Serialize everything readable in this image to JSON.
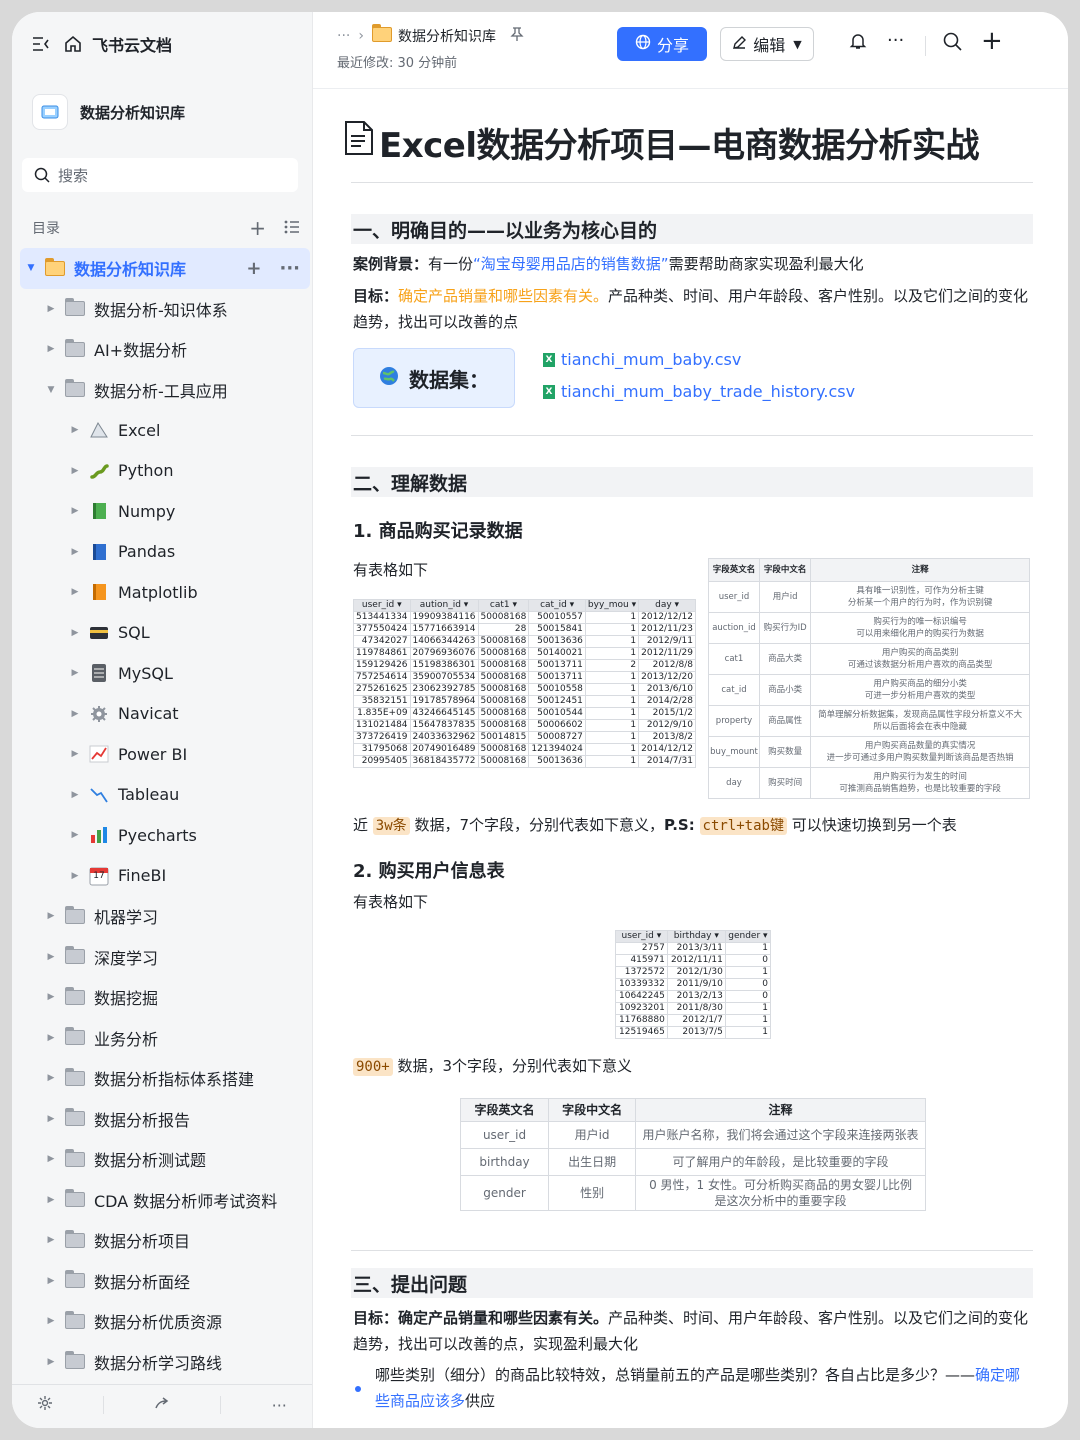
{
  "sidebar": {
    "app_name": "飞书云文档",
    "kb_name": "数据分析知识库",
    "search_placeholder": "搜索",
    "toc_label": "目录",
    "root": "数据分析知识库",
    "items": [
      {
        "label": "数据分析-知识体系",
        "level": 1
      },
      {
        "label": "AI+数据分析",
        "level": 1
      },
      {
        "label": "数据分析-工具应用",
        "level": 1,
        "expanded": true
      },
      {
        "label": "Excel",
        "level": 2,
        "icon": "chart-icon"
      },
      {
        "label": "Python",
        "level": 2,
        "icon": "snake-icon"
      },
      {
        "label": "Numpy",
        "level": 2,
        "icon": "green-book-icon"
      },
      {
        "label": "Pandas",
        "level": 2,
        "icon": "blue-book-icon"
      },
      {
        "label": "Matplotlib",
        "level": 2,
        "icon": "orange-book-icon"
      },
      {
        "label": "SQL",
        "level": 2,
        "icon": "card-icon"
      },
      {
        "label": "MySQL",
        "level": 2,
        "icon": "database-icon"
      },
      {
        "label": "Navicat",
        "level": 2,
        "icon": "gear-icon"
      },
      {
        "label": "Power BI",
        "level": 2,
        "icon": "line-chart-icon"
      },
      {
        "label": "Tableau",
        "level": 2,
        "icon": "trend-icon"
      },
      {
        "label": "Pyecharts",
        "level": 2,
        "icon": "bar-chart-icon"
      },
      {
        "label": "FineBI",
        "level": 2,
        "icon": "calendar-icon"
      },
      {
        "label": "机器学习",
        "level": 1
      },
      {
        "label": "深度学习",
        "level": 1
      },
      {
        "label": "数据挖掘",
        "level": 1
      },
      {
        "label": "业务分析",
        "level": 1
      },
      {
        "label": "数据分析指标体系搭建",
        "level": 1
      },
      {
        "label": "数据分析报告",
        "level": 1
      },
      {
        "label": "数据分析测试题",
        "level": 1
      },
      {
        "label": "CDA 数据分析师考试资料",
        "level": 1
      },
      {
        "label": "数据分析项目",
        "level": 1
      },
      {
        "label": "数据分析面经",
        "level": 1
      },
      {
        "label": "数据分析优质资源",
        "level": 1
      },
      {
        "label": "数据分析学习路线",
        "level": 1
      }
    ],
    "calendar_num": "17"
  },
  "header": {
    "breadcrumb_more": "···",
    "breadcrumb_current": "数据分析知识库",
    "modified": "最近修改: 30 分钟前",
    "share": "分享",
    "edit": "编辑"
  },
  "doc": {
    "title": "Excel数据分析项目—电商数据分析实战",
    "s1": "一、明确目的——以业务为核心目的",
    "bg_label": "案例背景：",
    "bg_pre": "有一份",
    "bg_link": "“淘宝母婴用品店的销售数据”",
    "bg_post": "需要帮助商家实现盈利最大化",
    "goal_label": "目标：",
    "goal_hl": "确定产品销量和哪些因素有关。",
    "goal_rest": "产品种类、时间、用户年龄段、客户性别。以及它们之间的变化趋势，找出可以改善的点",
    "dataset_label": "数据集：",
    "file1": "tianchi_mum_baby.csv",
    "file2": "tianchi_mum_baby_trade_history.csv",
    "s2": "二、理解数据",
    "h21": "1. 商品购买记录数据",
    "table_intro": "有表格如下",
    "p21_a": "近",
    "p21_code": "3w条",
    "p21_b": "数据，7个字段，分别代表如下意义，",
    "p21_ps": "P.S:",
    "p21_code2": "ctrl+tab键",
    "p21_c": "可以快速切换到另一个表",
    "h22": "2. 购买用户信息表",
    "table_intro2": "有表格如下",
    "p22_code": "900+",
    "p22_rest": "数据，3个字段，分别代表如下意义",
    "s3": "三、提出问题",
    "goal2_label": "目标：确定产品销量和哪些因素有关。",
    "goal2_rest": "产品种类、时间、用户年龄段、客户性别。以及它们之间的变化趋势，找出可以改善的点，实现盈利最大化",
    "q1_text": "哪些类别（细分）的商品比较特效，总销量前五的产品是哪些类别？各自占比是多少？——",
    "q1_link": "确定哪些商品应该多",
    "q1_end": "供应"
  },
  "sheet1": {
    "headers": [
      "user_id",
      "aution_id",
      "cat1",
      "cat_id",
      "byy_mou",
      "day"
    ],
    "rows": [
      [
        "513441334",
        "19909384116",
        "50008168",
        "50010557",
        "1",
        "2012/12/12"
      ],
      [
        "377550424",
        "15771663914",
        "28",
        "50015841",
        "1",
        "2012/11/23"
      ],
      [
        "47342027",
        "14066344263",
        "50008168",
        "50013636",
        "1",
        "2012/9/11"
      ],
      [
        "119784861",
        "20796936076",
        "50008168",
        "50140021",
        "1",
        "2012/11/29"
      ],
      [
        "159129426",
        "15198386301",
        "50008168",
        "50013711",
        "2",
        "2012/8/8"
      ],
      [
        "757254614",
        "35900705534",
        "50008168",
        "50013711",
        "1",
        "2013/12/20"
      ],
      [
        "275261625",
        "23062392785",
        "50008168",
        "50010558",
        "1",
        "2013/6/10"
      ],
      [
        "35832151",
        "19178578964",
        "50008168",
        "50012451",
        "1",
        "2014/2/28"
      ],
      [
        "1.835E+09",
        "43246645145",
        "50008168",
        "50010544",
        "1",
        "2015/1/2"
      ],
      [
        "131021484",
        "15647837835",
        "50008168",
        "50006602",
        "1",
        "2012/9/10"
      ],
      [
        "373726419",
        "24033632962",
        "50014815",
        "50008727",
        "1",
        "2013/8/2"
      ],
      [
        "31795068",
        "20749016489",
        "50008168",
        "121394024",
        "1",
        "2014/12/12"
      ],
      [
        "20995405",
        "36818435772",
        "50008168",
        "50013636",
        "1",
        "2014/7/31"
      ]
    ]
  },
  "fields1": {
    "headers": [
      "字段英文名",
      "字段中文名",
      "注释"
    ],
    "rows": [
      [
        "user_id",
        "用户id",
        "具有唯一识别性，可作为分析主键",
        "分析某一个用户的行为时，作为识别键"
      ],
      [
        "auction_id",
        "购买行为ID",
        "购买行为的唯一标识编号",
        "可以用来细化用户的购买行为数据"
      ],
      [
        "cat1",
        "商品大类",
        "用户购买的商品类别",
        "可通过该数据分析用户喜欢的商品类型"
      ],
      [
        "cat_id",
        "商品小类",
        "用户购买商品的细分小类",
        "可进一步分析用户喜欢的类型"
      ],
      [
        "property",
        "商品属性",
        "简单理解分析数据集，发现商品属性字段分析意义不大",
        "所以后面将会在表中隐藏"
      ],
      [
        "buy_mount",
        "购买数量",
        "用户购买商品数量的真实情况",
        "进一步可通过多用户购买数量判断该商品是否热销"
      ],
      [
        "day",
        "购买时间",
        "用户购买行为发生的时间",
        "可推测商品销售趋势，也是比较重要的字段"
      ]
    ]
  },
  "sheet2": {
    "headers": [
      "user_id",
      "birthday",
      "gender"
    ],
    "rows": [
      [
        "2757",
        "2013/3/11",
        "1"
      ],
      [
        "415971",
        "2012/11/11",
        "0"
      ],
      [
        "1372572",
        "2012/1/30",
        "1"
      ],
      [
        "10339332",
        "2011/9/10",
        "0"
      ],
      [
        "10642245",
        "2013/2/13",
        "0"
      ],
      [
        "10923201",
        "2011/8/30",
        "1"
      ],
      [
        "11768880",
        "2012/1/7",
        "1"
      ],
      [
        "12519465",
        "2013/7/5",
        "1"
      ]
    ]
  },
  "fields2": {
    "headers": [
      "字段英文名",
      "字段中文名",
      "注释"
    ],
    "rows": [
      [
        "user_id",
        "用户id",
        "用户账户名称，我们将会通过这个字段来连接两张表",
        ""
      ],
      [
        "birthday",
        "出生日期",
        "可了解用户的年龄段，是比较重要的字段",
        ""
      ],
      [
        "gender",
        "性别",
        "0 男性，1 女性。可分析购买商品的男女婴儿比例",
        "是这次分析中的重要字段"
      ]
    ]
  },
  "colors": {
    "accent": "#3370ff",
    "highlight": "#f7a21a",
    "code_bg": "#fbe4c6"
  }
}
